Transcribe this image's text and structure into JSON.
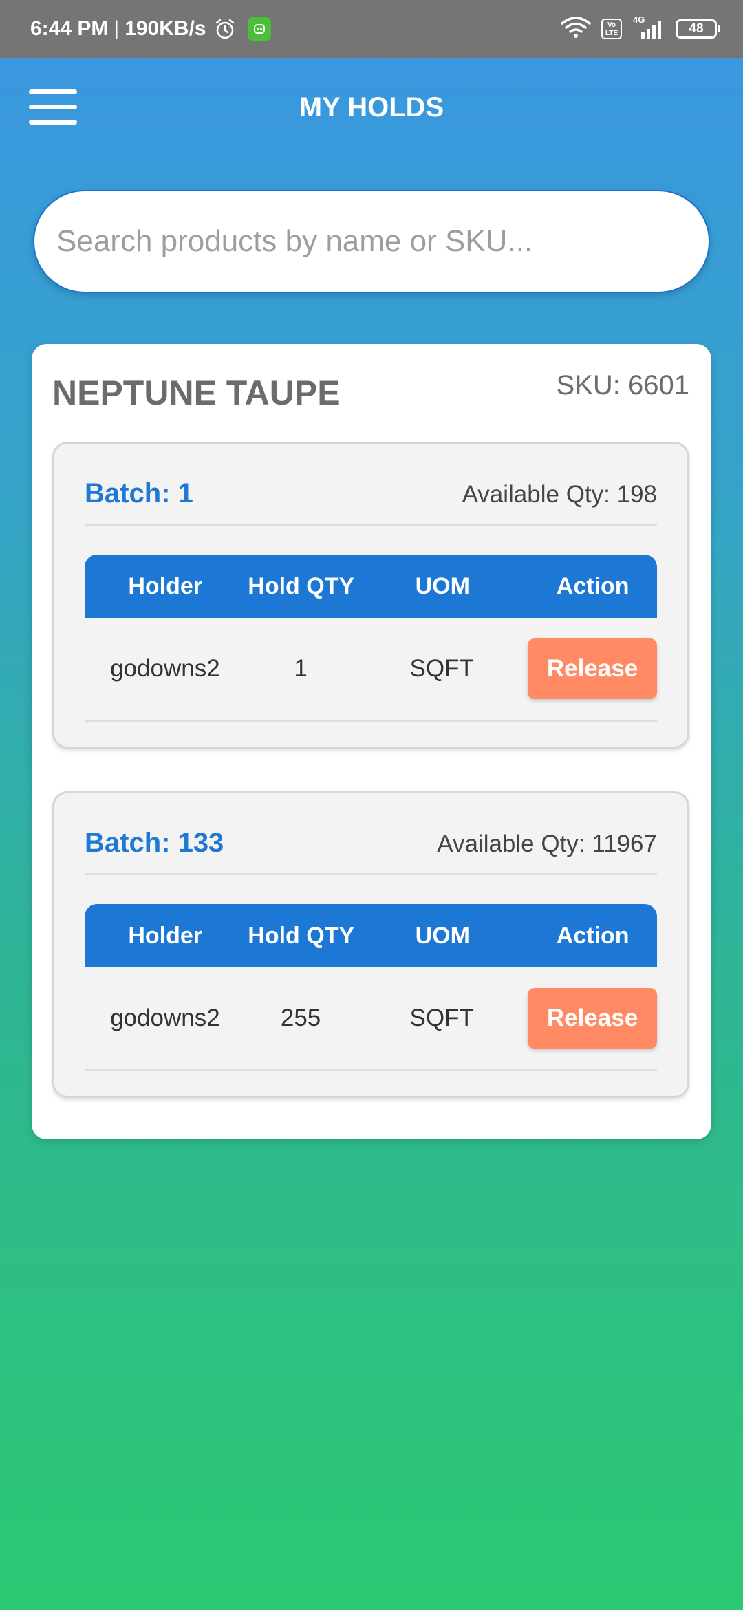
{
  "status_bar": {
    "time": "6:44 PM",
    "separator": "|",
    "network_speed": "190KB/s",
    "network_type": "4G",
    "volte_label": "Vo LTE",
    "battery": "48",
    "icons": [
      "alarm-icon",
      "app-notification-icon",
      "wifi-icon",
      "volte-icon",
      "signal-icon",
      "battery-icon"
    ]
  },
  "header": {
    "title": "MY HOLDS",
    "menu_icon": "hamburger-menu-icon"
  },
  "search": {
    "placeholder": "Search products by name or SKU...",
    "value": ""
  },
  "product": {
    "name": "NEPTUNE TAUPE",
    "sku_label": "SKU: 6601",
    "batches": [
      {
        "title": "Batch: 1",
        "available": "Available Qty: 198",
        "columns": [
          "Holder",
          "Hold QTY",
          "UOM",
          "Action"
        ],
        "rows": [
          {
            "holder": "godowns2",
            "hold_qty": "1",
            "uom": "SQFT",
            "action": "Release"
          }
        ]
      },
      {
        "title": "Batch: 133",
        "available": "Available Qty: 11967",
        "columns": [
          "Holder",
          "Hold QTY",
          "UOM",
          "Action"
        ],
        "rows": [
          {
            "holder": "godowns2",
            "hold_qty": "255",
            "uom": "SQFT",
            "action": "Release"
          }
        ]
      }
    ]
  },
  "colors": {
    "accent_blue": "#1d77d4",
    "release_orange": "#ff8a63",
    "gradient_top": "#3a96e2",
    "gradient_bottom": "#2cc872"
  }
}
